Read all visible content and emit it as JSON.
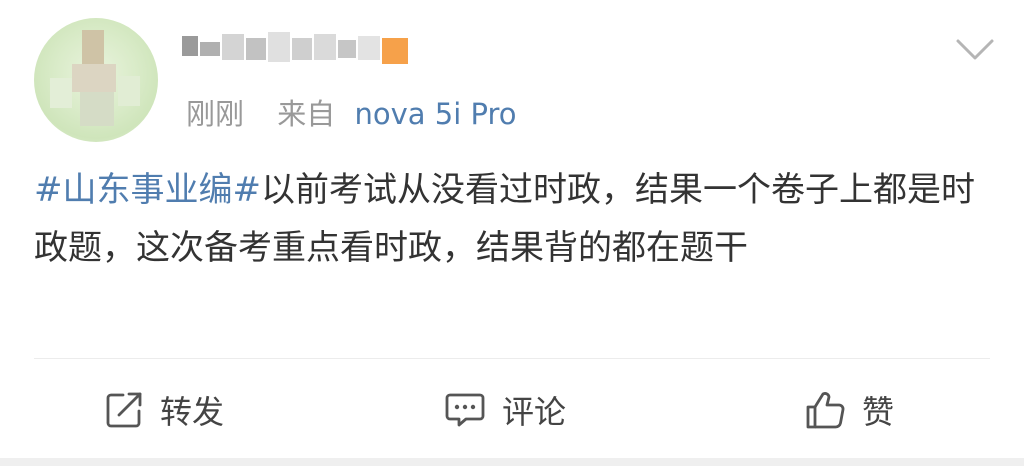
{
  "post": {
    "time": "刚刚",
    "from_label": "来自",
    "device": "nova 5i Pro",
    "hashtag": "#山东事业编#",
    "text": "以前考试从没看过时政，结果一个卷子上都是时政题，这次备考重点看时政，结果背的都在题干"
  },
  "actions": {
    "repost": "转发",
    "comment": "评论",
    "like": "赞"
  },
  "colors": {
    "link": "#507daf",
    "meta": "#999999",
    "text": "#333333"
  },
  "icons": [
    "chevron-down-icon",
    "repost-icon",
    "comment-icon",
    "thumbs-up-icon"
  ]
}
